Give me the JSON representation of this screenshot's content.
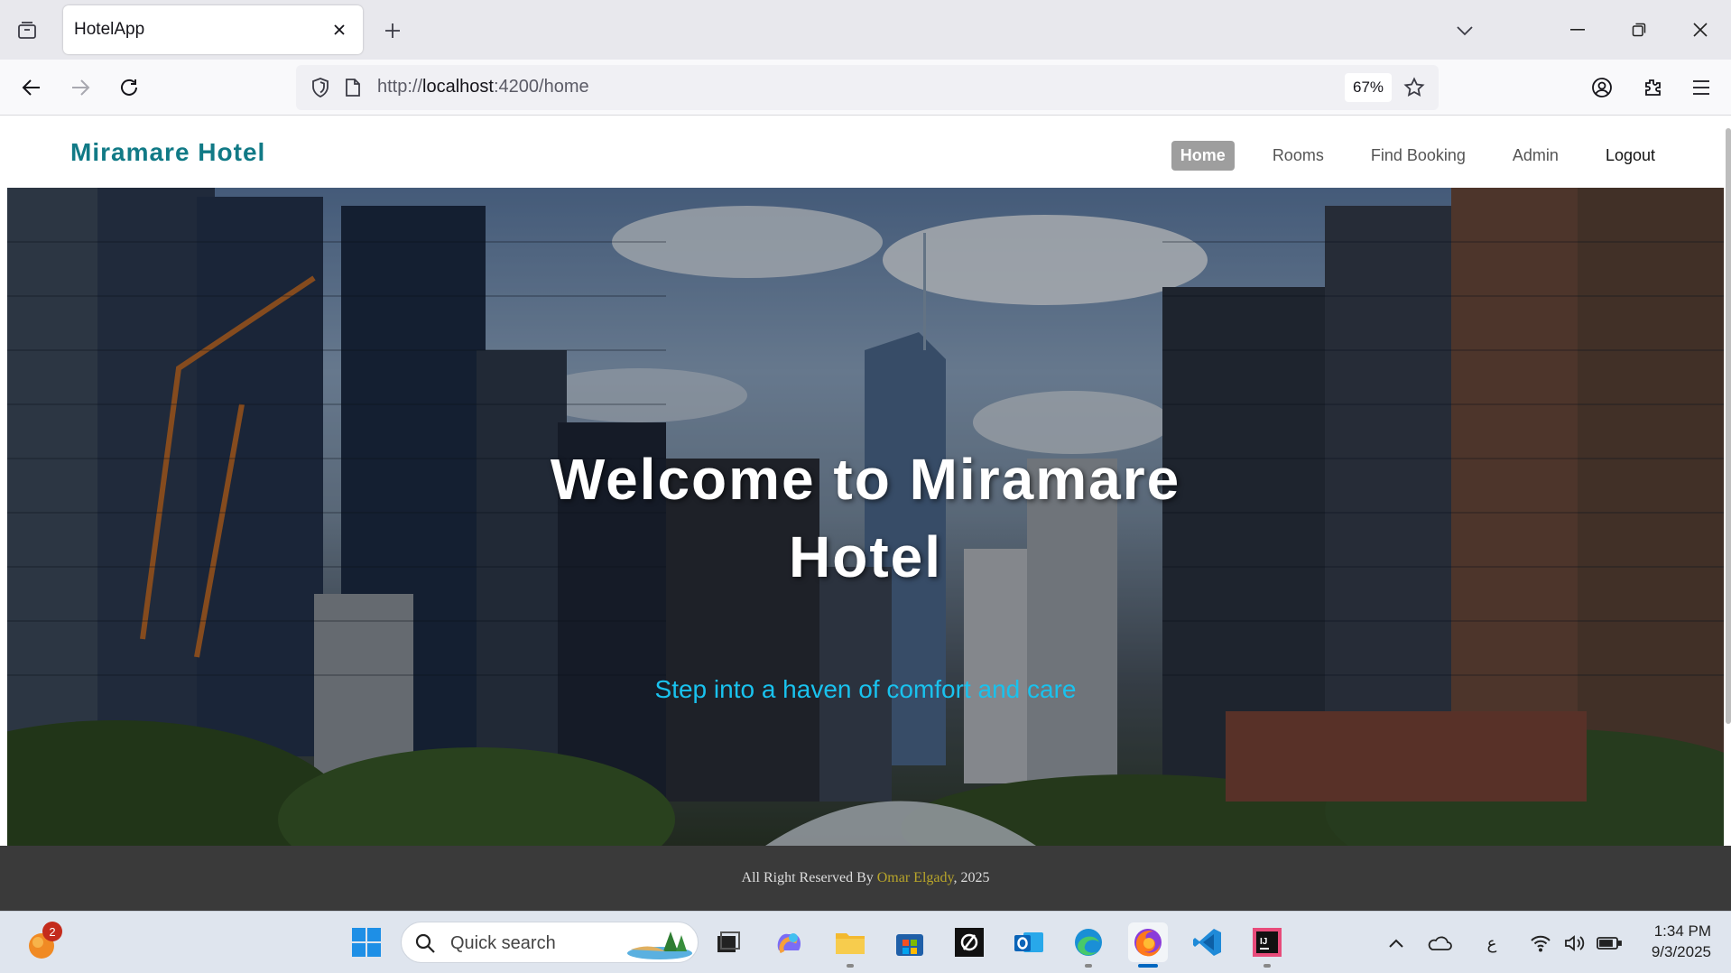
{
  "browser": {
    "tab_title": "HotelApp",
    "url_prefix": "http://",
    "url_host": "localhost",
    "url_path": ":4200/home",
    "zoom": "67%"
  },
  "site": {
    "brand": "Miramare Hotel",
    "nav": {
      "home": "Home",
      "rooms": "Rooms",
      "find_booking": "Find Booking",
      "admin": "Admin",
      "logout": "Logout"
    },
    "hero": {
      "title_line1": "Welcome to Miramare",
      "title_line2": "Hotel",
      "subtitle": "Step into a haven of comfort and care"
    },
    "footer": {
      "prefix": "All Right Reserved By ",
      "author": "Omar Elgady",
      "suffix": ", 2025"
    },
    "colors": {
      "brand": "#117a86",
      "subtitle": "#19c2ee",
      "active_nav": "#9e9e9e",
      "footer_bg": "#3a3a3a",
      "footer_author": "#b8a52a"
    }
  },
  "taskbar": {
    "notification_count": "2",
    "search_placeholder": "Quick search",
    "tray_lang": "ع",
    "time": "1:34 PM",
    "date": "9/3/2025",
    "apps": [
      "start-icon",
      "task-view-icon",
      "copilot-icon",
      "file-explorer-icon",
      "store-icon",
      "github-icon",
      "outlook-icon",
      "edge-icon",
      "firefox-icon",
      "vscode-icon",
      "intellij-icon"
    ]
  }
}
